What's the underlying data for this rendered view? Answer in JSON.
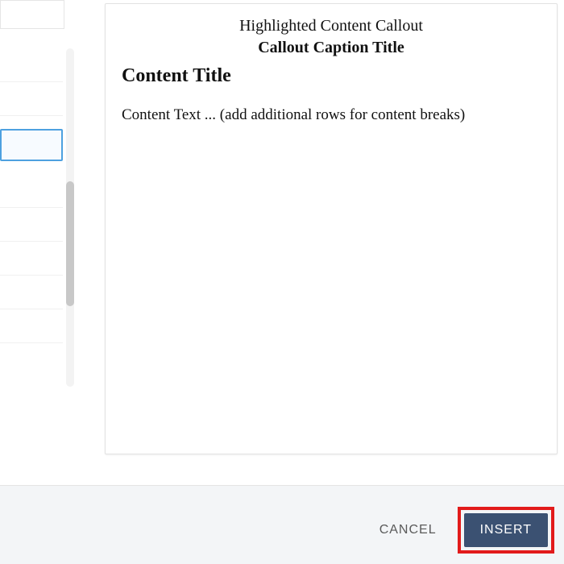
{
  "preview": {
    "callout_heading": "Highlighted Content Callout",
    "caption_title": "Callout Caption Title",
    "content_title": "Content Title",
    "content_text": "Content Text ... (add additional rows for content breaks)"
  },
  "actions": {
    "cancel_label": "CANCEL",
    "insert_label": "INSERT"
  }
}
